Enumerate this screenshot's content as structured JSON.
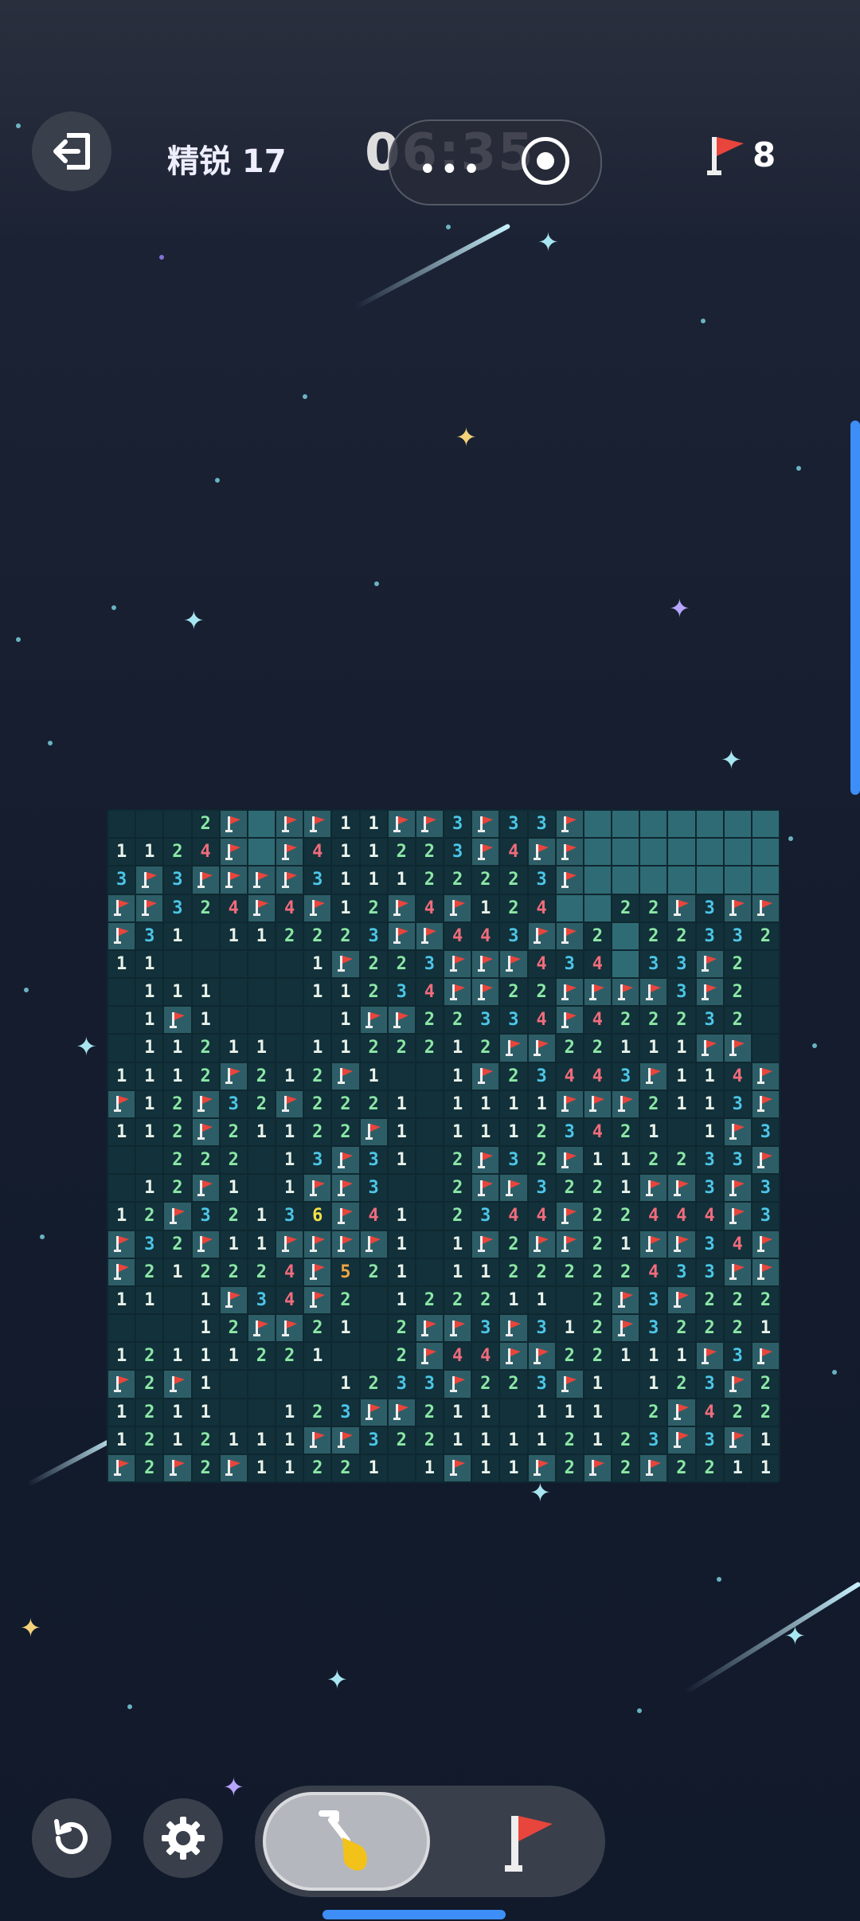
{
  "header": {
    "level_label": "精锐 17",
    "timer": "06:35",
    "flags_remaining": "8"
  },
  "recording_overlay": {
    "dots": "•••"
  },
  "board": {
    "rows": [
      "...2F-FF11FF3F33F-------",
      "112 4F-F4112 23F4F-------",
      "3F3FFFF3111222223F------",
      "FF324FF4F12F4F124--22F3FF",
      "F31 11222223FF4F43FF22--2323 2",
      "11    1F223FFF4344--33F2.",
      ".111   112234FF22FFFF3F2.",
      ".1F1     1FF2233F4F4222232",
      ".1121 1 11222212FF22111FF",
      "1112F212F1  1F2344F3F11 4F",
      "F12F32F2221 111F FF2113F",
      "112F211222F1 11123F421 1F3",
      "..222 13F31 2F32F112233F",
      ".12F1 1FFF3  2FF3221FF3F3",
      "12F3213F6F41 2344F224 4F3",
      "F32F11FFFF1 1F2FF21FF34F",
      "F212224F5F21 1122222F4333F",
      "11 1F34F2 122211 2F3F222",
      "...12FF21 2FF3F3F12F32221",
      "1211122 1 2F4 4F222111F3F",
      "F2F1    1233F223F1 123F2",
      "1211  123FF2111 112F422",
      "1212111FF3F22211121F2F3F1",
      "F2F2F1122221 1F11F2F2F2211"
    ]
  },
  "grid": [
    [
      "e",
      "e",
      "e",
      "2",
      "F",
      "H",
      "F",
      "F",
      "1",
      "1",
      "F",
      "F",
      "3",
      "F",
      "3",
      "3",
      "F",
      "H",
      "H",
      "H",
      "H",
      "H",
      "H",
      "H"
    ],
    [
      "1",
      "1",
      "2",
      "4",
      "F",
      "H",
      "F",
      "4",
      "1",
      "1",
      "2",
      "2",
      "3",
      "F",
      "4",
      "F",
      "F",
      "H",
      "H",
      "H",
      "H",
      "H",
      "H",
      "H"
    ],
    [
      "3",
      "F",
      "3",
      "F",
      "F",
      "F",
      "F",
      "3",
      "1",
      "1",
      "1",
      "2",
      "2",
      "2",
      "2",
      "3",
      "F",
      "H",
      "H",
      "H",
      "H",
      "H",
      "H",
      "H"
    ],
    [
      "F",
      "F",
      "3",
      "2",
      "4",
      "F",
      "4",
      "F",
      "1",
      "2",
      "F",
      "4",
      "F",
      "1",
      "2",
      "4",
      "H",
      "H",
      "2",
      "2",
      "F",
      "3",
      "F",
      "F"
    ],
    [
      "F",
      "3",
      "1",
      "e",
      "1",
      "1",
      "2",
      "2",
      "2",
      "3",
      "F",
      "F",
      "4",
      "4",
      "3",
      "F",
      "F",
      "2",
      "H",
      "2",
      "2",
      "3",
      "3",
      "2"
    ],
    [
      "1",
      "1",
      "e",
      "e",
      "e",
      "e",
      "e",
      "1",
      "F",
      "2",
      "2",
      "3",
      "F",
      "F",
      "F",
      "4",
      "3",
      "4",
      "H",
      "3",
      "3",
      "F",
      "2",
      "e"
    ],
    [
      "e",
      "1",
      "1",
      "1",
      "e",
      "e",
      "e",
      "1",
      "1",
      "2",
      "3",
      "4",
      "F",
      "F",
      "2",
      "2",
      "F",
      "F",
      "F",
      "F",
      "3",
      "F",
      "2",
      "e"
    ],
    [
      "e",
      "1",
      "F",
      "1",
      "e",
      "e",
      "e",
      "e",
      "1",
      "F",
      "F",
      "2",
      "2",
      "3",
      "3",
      "4",
      "F",
      "4",
      "2",
      "2",
      "2",
      "3",
      "2",
      "e"
    ],
    [
      "e",
      "1",
      "1",
      "2",
      "1",
      "1",
      "e",
      "1",
      "1",
      "2",
      "2",
      "2",
      "1",
      "2",
      "F",
      "F",
      "2",
      "2",
      "1",
      "1",
      "1",
      "F",
      "F",
      "e"
    ],
    [
      "1",
      "1",
      "1",
      "2",
      "F",
      "2",
      "1",
      "2",
      "F",
      "1",
      "e",
      "e",
      "1",
      "F",
      "2",
      "3",
      "4",
      "4",
      "3",
      "F",
      "1",
      "1",
      "4",
      "F"
    ],
    [
      "F",
      "1",
      "2",
      "F",
      "3",
      "2",
      "F",
      "2",
      "2",
      "2",
      "1",
      "e",
      "1",
      "1",
      "1",
      "1",
      "F",
      "F",
      "F",
      "2",
      "1",
      "1",
      "3",
      "F"
    ],
    [
      "1",
      "1",
      "2",
      "F",
      "2",
      "1",
      "1",
      "2",
      "2",
      "F",
      "1",
      "e",
      "1",
      "1",
      "1",
      "2",
      "3",
      "4",
      "2",
      "1",
      "e",
      "1",
      "F",
      "3"
    ],
    [
      "e",
      "e",
      "2",
      "2",
      "2",
      "e",
      "1",
      "3",
      "F",
      "3",
      "1",
      "e",
      "2",
      "F",
      "3",
      "2",
      "F",
      "1",
      "1",
      "2",
      "2",
      "3",
      "3",
      "F"
    ],
    [
      "e",
      "1",
      "2",
      "F",
      "1",
      "e",
      "1",
      "F",
      "F",
      "3",
      "e",
      "e",
      "2",
      "F",
      "F",
      "3",
      "2",
      "2",
      "1",
      "F",
      "F",
      "3",
      "F",
      "3"
    ],
    [
      "1",
      "2",
      "F",
      "3",
      "2",
      "1",
      "3",
      "6",
      "F",
      "4",
      "1",
      "e",
      "2",
      "3",
      "4",
      "4",
      "F",
      "2",
      "2",
      "4",
      "4",
      "4",
      "F",
      "3"
    ],
    [
      "F",
      "3",
      "2",
      "F",
      "1",
      "1",
      "F",
      "F",
      "F",
      "F",
      "1",
      "e",
      "1",
      "F",
      "2",
      "F",
      "F",
      "2",
      "1",
      "F",
      "F",
      "3",
      "4",
      "F"
    ],
    [
      "F",
      "2",
      "1",
      "2",
      "2",
      "2",
      "4",
      "F",
      "5",
      "2",
      "1",
      "e",
      "1",
      "1",
      "2",
      "2",
      "2",
      "2",
      "2",
      "4",
      "3",
      "3",
      "F",
      "F"
    ],
    [
      "1",
      "1",
      "e",
      "1",
      "F",
      "3",
      "4",
      "F",
      "2",
      "e",
      "1",
      "2",
      "2",
      "2",
      "1",
      "1",
      "e",
      "2",
      "F",
      "3",
      "F",
      "2",
      "2",
      "2"
    ],
    [
      "e",
      "e",
      "e",
      "1",
      "2",
      "F",
      "F",
      "2",
      "1",
      "e",
      "2",
      "F",
      "F",
      "3",
      "F",
      "3",
      "1",
      "2",
      "F",
      "3",
      "2",
      "2",
      "2",
      "1"
    ],
    [
      "1",
      "2",
      "1",
      "1",
      "1",
      "2",
      "2",
      "1",
      "e",
      "e",
      "2",
      "F",
      "4",
      "4",
      "F",
      "F",
      "2",
      "2",
      "1",
      "1",
      "1",
      "F",
      "3",
      "F"
    ],
    [
      "F",
      "2",
      "F",
      "1",
      "e",
      "e",
      "e",
      "e",
      "1",
      "2",
      "3",
      "3",
      "F",
      "2",
      "2",
      "3",
      "F",
      "1",
      "e",
      "1",
      "2",
      "3",
      "F",
      "2"
    ],
    [
      "1",
      "2",
      "1",
      "1",
      "e",
      "e",
      "1",
      "2",
      "3",
      "F",
      "F",
      "2",
      "1",
      "1",
      "e",
      "1",
      "1",
      "1",
      "e",
      "2",
      "F",
      "4",
      "2",
      "2"
    ],
    [
      "1",
      "2",
      "1",
      "2",
      "1",
      "1",
      "1",
      "F",
      "F",
      "3",
      "2",
      "2",
      "1",
      "1",
      "1",
      "1",
      "2",
      "1",
      "2",
      "3",
      "F",
      "3",
      "F",
      "1"
    ],
    [
      "F",
      "2",
      "F",
      "2",
      "F",
      "1",
      "1",
      "2",
      "2",
      "1",
      "e",
      "1",
      "F",
      "1",
      "1",
      "F",
      "2",
      "F",
      "2",
      "F",
      "2",
      "2",
      "1",
      "1"
    ]
  ],
  "controls": {
    "exit": "exit-icon",
    "restart": "restart-icon",
    "settings": "gear-icon",
    "dig_mode": "shovel-icon",
    "flag_mode": "flag-icon"
  },
  "colors": {
    "accent_blue": "#3e8ef7",
    "flag_red": "#e8453c",
    "number_1": "#e9f2ea",
    "number_2": "#8be7a6",
    "number_3": "#4cc6e8",
    "number_4": "#f06c7c",
    "number_5": "#f1a640",
    "number_6": "#f4e04a"
  }
}
